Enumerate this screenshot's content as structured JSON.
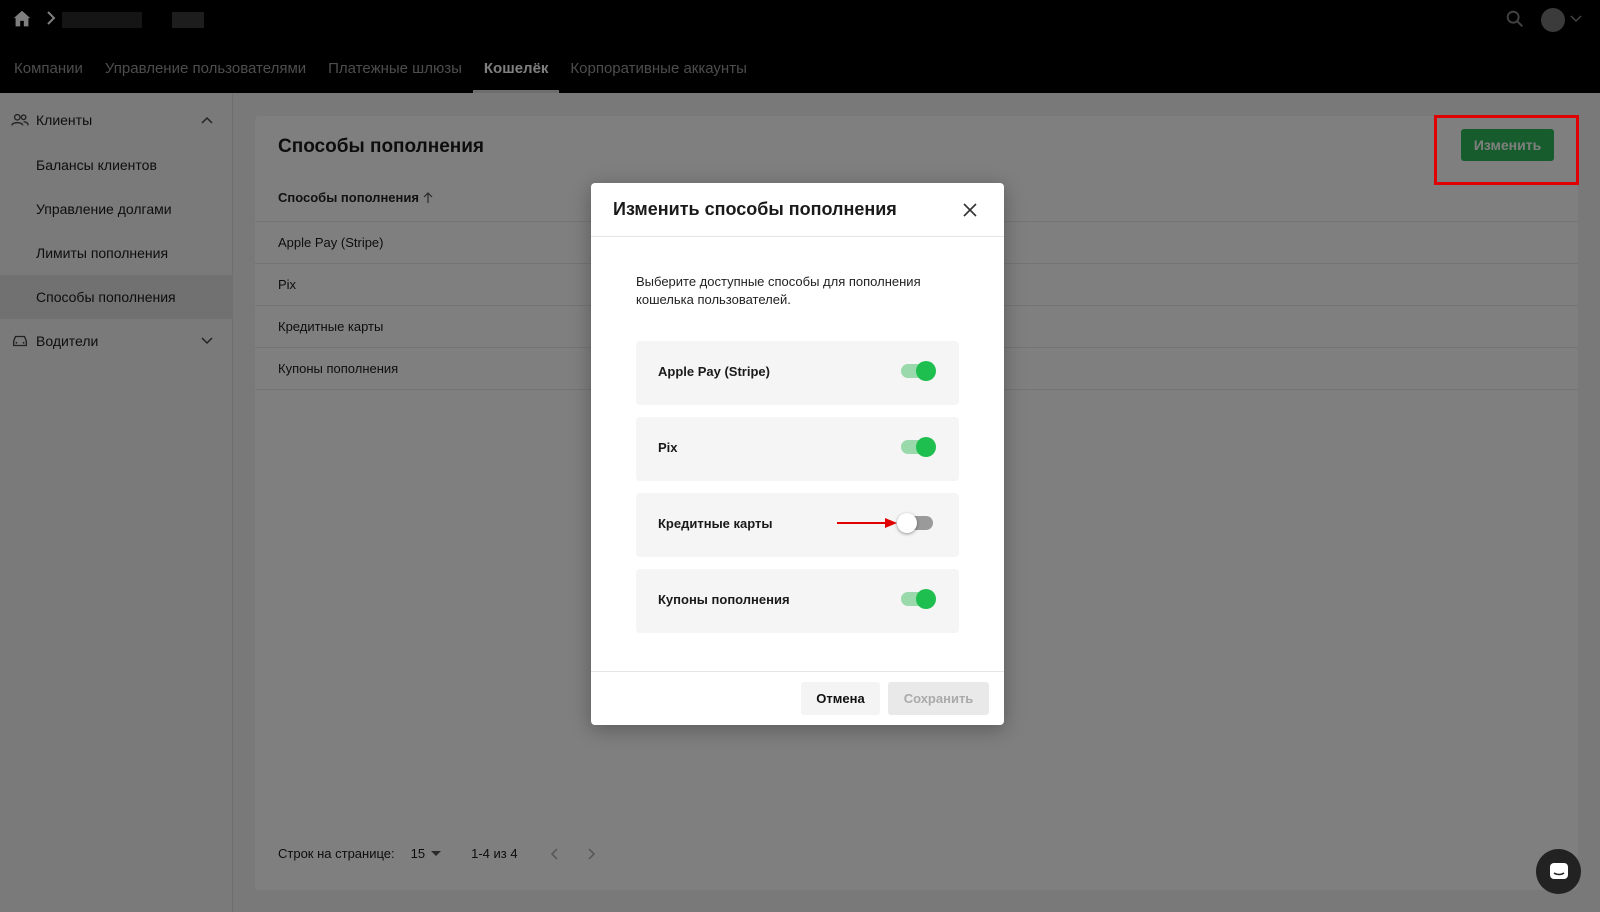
{
  "header": {
    "nav_tabs": [
      {
        "label": "Компании"
      },
      {
        "label": "Управление пользователями"
      },
      {
        "label": "Платежные шлюзы"
      },
      {
        "label": "Кошелёк"
      },
      {
        "label": "Корпоративные аккаунты"
      }
    ],
    "active_tab": "Кошелёк"
  },
  "sidebar": {
    "groups": [
      {
        "label": "Клиенты",
        "icon": "users-icon",
        "expanded": true,
        "items": [
          "Балансы клиентов",
          "Управление долгами",
          "Лимиты пополнения",
          "Способы пополнения"
        ]
      },
      {
        "label": "Водители",
        "icon": "car-icon",
        "expanded": false
      }
    ],
    "active_item": "Способы пополнения"
  },
  "main": {
    "title": "Способы пополнения",
    "edit_label": "Изменить",
    "column_header": "Способы пополнения",
    "rows": [
      "Apple Pay (Stripe)",
      "Pix",
      "Кредитные карты",
      "Купоны пополнения"
    ],
    "footer": {
      "rows_per_page_label": "Строк на странице:",
      "rows_per_page_value": "15",
      "range": "1-4 из 4"
    }
  },
  "modal": {
    "title": "Изменить способы пополнения",
    "description": "Выберите доступные способы для пополнения кошелька пользователей.",
    "options": [
      {
        "label": "Apple Pay (Stripe)",
        "enabled": true
      },
      {
        "label": "Pix",
        "enabled": true
      },
      {
        "label": "Кредитные карты",
        "enabled": false
      },
      {
        "label": "Купоны пополнения",
        "enabled": true
      }
    ],
    "cancel_label": "Отмена",
    "save_label": "Сохранить"
  },
  "colors": {
    "accent_green": "#2db85a",
    "toggle_on": "#1fbf4f",
    "highlight_red": "#e00000"
  }
}
